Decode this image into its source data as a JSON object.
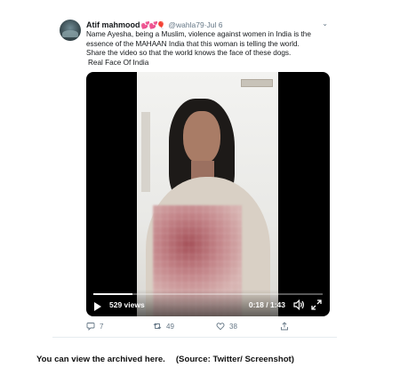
{
  "tweet": {
    "author": {
      "display_name": "Atif mahmood",
      "emoji": "💕💕🎈",
      "handle": "@wahla79",
      "date_separator": " · ",
      "date": "Jul 6"
    },
    "text_lines": [
      "Name Ayesha, being a Muslim, violence against women in India is the",
      "essence of the MAHAAN India that this woman is telling the world.",
      "Share the video so that the world knows the face of these dogs.",
      "Real Face Of India"
    ],
    "video": {
      "views": "529 views",
      "time": "0:18 / 1:43",
      "progress": 0.17
    },
    "actions": {
      "replies": "7",
      "retweets": "49",
      "likes": "38"
    }
  },
  "caption": {
    "text": "You can view the archived here.",
    "source": "(Source: Twitter/ Screenshot)"
  },
  "colors": {
    "secondary_text": "#657786",
    "heart_emoji": "#e0245e",
    "video_bg": "#000000"
  },
  "icons": [
    "avatar",
    "chevron-down-icon",
    "play-icon",
    "volume-icon",
    "fullscreen-icon",
    "reply-icon",
    "retweet-icon",
    "like-icon",
    "share-icon"
  ]
}
